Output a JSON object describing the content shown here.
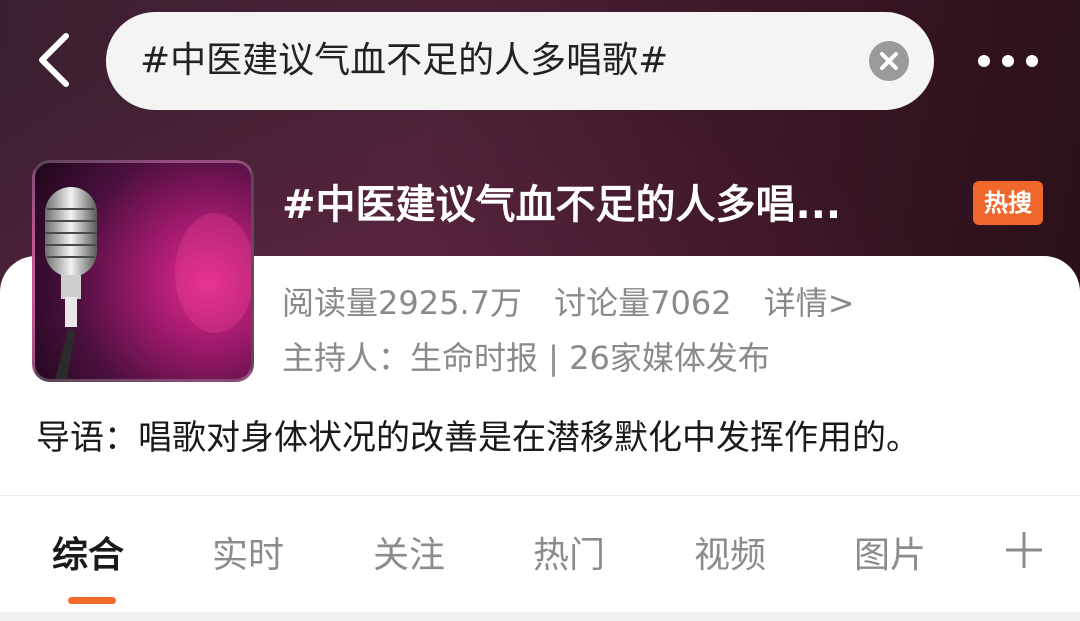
{
  "search": {
    "query": "#中医建议气血不足的人多唱歌#"
  },
  "topic": {
    "title": "#中医建议气血不足的人多唱...",
    "badge": "热搜",
    "reads": "阅读量2925.7万",
    "discussions": "讨论量7062",
    "detail_link": "详情>",
    "host_line": "主持人：生命时报 | 26家媒体发布",
    "intro": "导语：唱歌对身体状况的改善是在潜移默化中发挥作用的。"
  },
  "tabs": [
    {
      "label": "综合",
      "active": true
    },
    {
      "label": "实时",
      "active": false
    },
    {
      "label": "关注",
      "active": false
    },
    {
      "label": "热门",
      "active": false
    },
    {
      "label": "视频",
      "active": false
    },
    {
      "label": "图片",
      "active": false
    }
  ],
  "icons": {
    "back": "chevron-left-icon",
    "clear": "clear-icon",
    "more": "more-dots-icon",
    "tab_more": "plus-icon"
  },
  "colors": {
    "accent": "#f36b2a",
    "badge": "#f0672b",
    "header_bg": "#3b1f30"
  }
}
